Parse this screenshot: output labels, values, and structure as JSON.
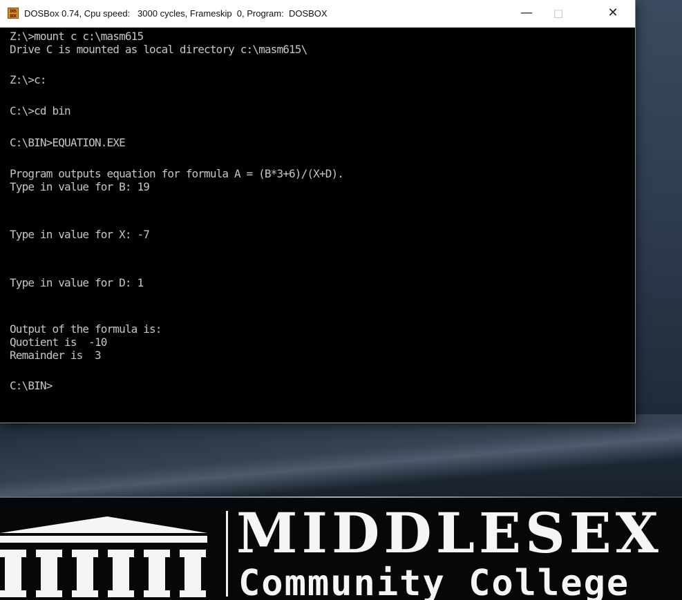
{
  "window": {
    "title": "DOSBox 0.74, Cpu speed:   3000 cycles, Frameskip  0, Program:  DOSBOX",
    "icon_label": "DOS BOX",
    "controls": {
      "minimize": "—",
      "maximize": "□",
      "close": "✕"
    }
  },
  "terminal": {
    "lines": [
      "Z:\\>mount c c:\\masm615",
      "Drive C is mounted as local directory c:\\masm615\\",
      "Z:\\>c:",
      "C:\\>cd bin",
      "C:\\BIN>EQUATION.EXE",
      "Program outputs equation for formula A = (B*3+6)/(X+D).",
      "Type in value for B: 19",
      "Type in value for X: -7",
      "Type in value for D: 1",
      "Output of the formula is:",
      "Quotient is  -10",
      "Remainder is  3",
      "C:\\BIN>"
    ]
  },
  "logo": {
    "name": "MIDDLESEX",
    "subtitle": "Community College"
  },
  "colors": {
    "terminal_bg": "#000000",
    "terminal_fg": "#c6c6c6",
    "titlebar_bg": "#ffffff",
    "logo_fg": "#f5f5f5"
  }
}
